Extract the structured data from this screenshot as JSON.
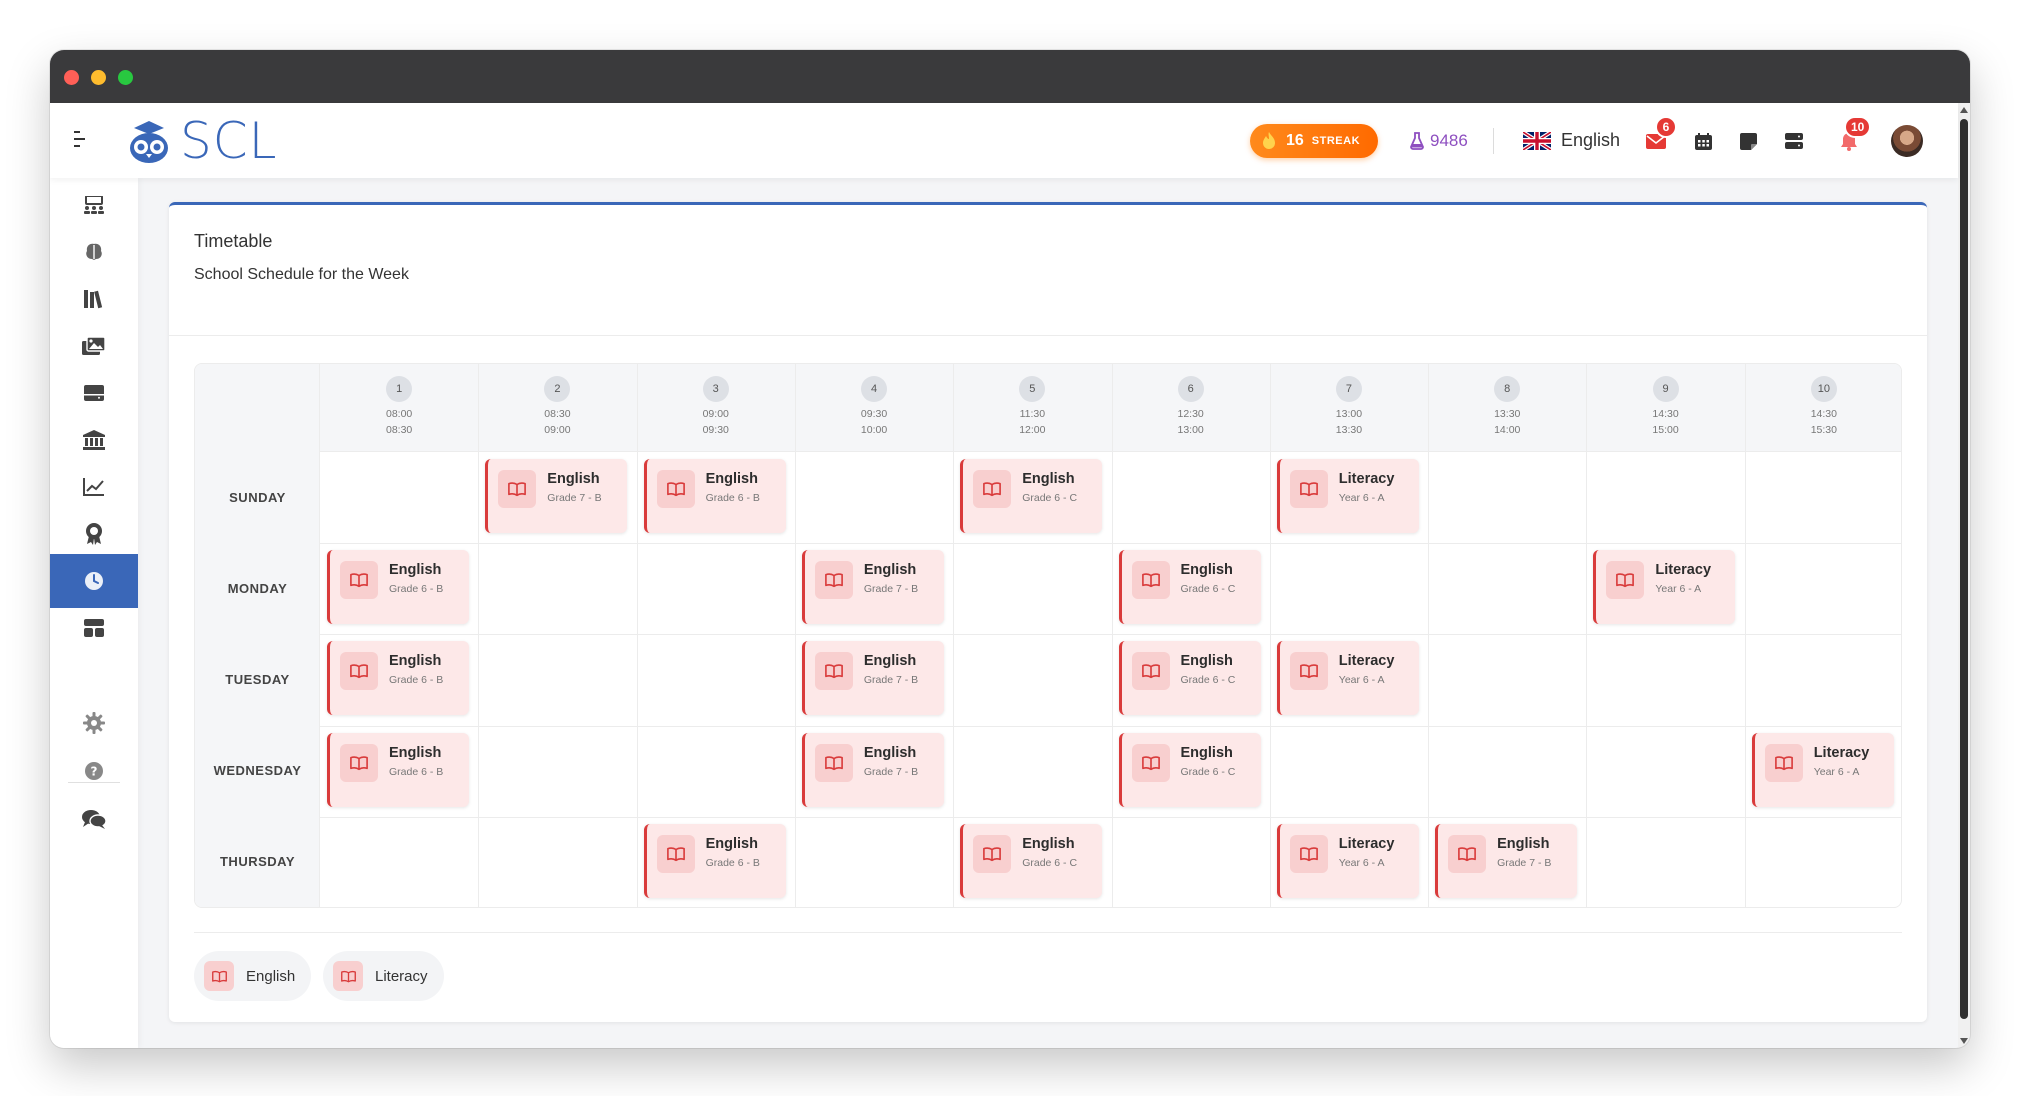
{
  "app": {
    "logo_text": "SCL"
  },
  "header": {
    "streak_count": "16",
    "streak_label": "STREAK",
    "points": "9486",
    "language": "English",
    "mail_badge": "6",
    "notification_badge": "10"
  },
  "card": {
    "title": "Timetable",
    "subtitle": "School Schedule for the Week"
  },
  "periods": [
    {
      "number": "1",
      "start": "08:00",
      "end": "08:30"
    },
    {
      "number": "2",
      "start": "08:30",
      "end": "09:00"
    },
    {
      "number": "3",
      "start": "09:00",
      "end": "09:30"
    },
    {
      "number": "4",
      "start": "09:30",
      "end": "10:00"
    },
    {
      "number": "5",
      "start": "11:30",
      "end": "12:00"
    },
    {
      "number": "6",
      "start": "12:30",
      "end": "13:00"
    },
    {
      "number": "7",
      "start": "13:00",
      "end": "13:30"
    },
    {
      "number": "8",
      "start": "13:30",
      "end": "14:00"
    },
    {
      "number": "9",
      "start": "14:30",
      "end": "15:00"
    },
    {
      "number": "10",
      "start": "14:30",
      "end": "15:30"
    }
  ],
  "days": [
    "SUNDAY",
    "MONDAY",
    "TUESDAY",
    "WEDNESDAY",
    "THURSDAY"
  ],
  "lessons": [
    {
      "day": 0,
      "period": 1,
      "subject": "English",
      "class": "Grade 7 - B"
    },
    {
      "day": 0,
      "period": 2,
      "subject": "English",
      "class": "Grade 6 - B"
    },
    {
      "day": 0,
      "period": 4,
      "subject": "English",
      "class": "Grade 6 - C"
    },
    {
      "day": 0,
      "period": 6,
      "subject": "Literacy",
      "class": "Year 6 - A"
    },
    {
      "day": 1,
      "period": 0,
      "subject": "English",
      "class": "Grade 6 - B"
    },
    {
      "day": 1,
      "period": 3,
      "subject": "English",
      "class": "Grade 7 - B"
    },
    {
      "day": 1,
      "period": 5,
      "subject": "English",
      "class": "Grade 6 - C"
    },
    {
      "day": 1,
      "period": 8,
      "subject": "Literacy",
      "class": "Year 6 - A"
    },
    {
      "day": 2,
      "period": 0,
      "subject": "English",
      "class": "Grade 6 - B"
    },
    {
      "day": 2,
      "period": 3,
      "subject": "English",
      "class": "Grade 7 - B"
    },
    {
      "day": 2,
      "period": 5,
      "subject": "English",
      "class": "Grade 6 - C"
    },
    {
      "day": 2,
      "period": 6,
      "subject": "Literacy",
      "class": "Year 6 - A"
    },
    {
      "day": 3,
      "period": 0,
      "subject": "English",
      "class": "Grade 6 - B"
    },
    {
      "day": 3,
      "period": 3,
      "subject": "English",
      "class": "Grade 7 - B"
    },
    {
      "day": 3,
      "period": 5,
      "subject": "English",
      "class": "Grade 6 - C"
    },
    {
      "day": 3,
      "period": 9,
      "subject": "Literacy",
      "class": "Year 6 - A"
    },
    {
      "day": 4,
      "period": 2,
      "subject": "English",
      "class": "Grade 6 - B"
    },
    {
      "day": 4,
      "period": 4,
      "subject": "English",
      "class": "Grade 6 - C"
    },
    {
      "day": 4,
      "period": 6,
      "subject": "Literacy",
      "class": "Year 6 - A"
    },
    {
      "day": 4,
      "period": 7,
      "subject": "English",
      "class": "Grade 7 - B"
    }
  ],
  "legend": [
    "English",
    "Literacy"
  ],
  "sidebar": {
    "items": [
      {
        "name": "sidebar-item-classes",
        "icon": "classroom-icon"
      },
      {
        "name": "sidebar-item-brain",
        "icon": "brain-icon"
      },
      {
        "name": "sidebar-item-library",
        "icon": "books-icon"
      },
      {
        "name": "sidebar-item-gallery",
        "icon": "images-icon"
      },
      {
        "name": "sidebar-item-storage",
        "icon": "drive-icon"
      },
      {
        "name": "sidebar-item-school",
        "icon": "institution-icon"
      },
      {
        "name": "sidebar-item-analytics",
        "icon": "chart-line-icon"
      },
      {
        "name": "sidebar-item-awards",
        "icon": "award-icon"
      },
      {
        "name": "sidebar-item-timetable",
        "icon": "clock-icon",
        "active": true
      },
      {
        "name": "sidebar-item-layout",
        "icon": "layout-icon"
      },
      {
        "name": "sidebar-item-settings",
        "icon": "gear-icon"
      },
      {
        "name": "sidebar-item-help",
        "icon": "help-icon"
      },
      {
        "name": "sidebar-item-chat",
        "icon": "chat-icon"
      }
    ]
  },
  "colors": {
    "accent": "#3a67b8",
    "lesson_bg": "#fde8e8",
    "lesson_border": "#d93b3b",
    "streak": "#ff7a10"
  }
}
